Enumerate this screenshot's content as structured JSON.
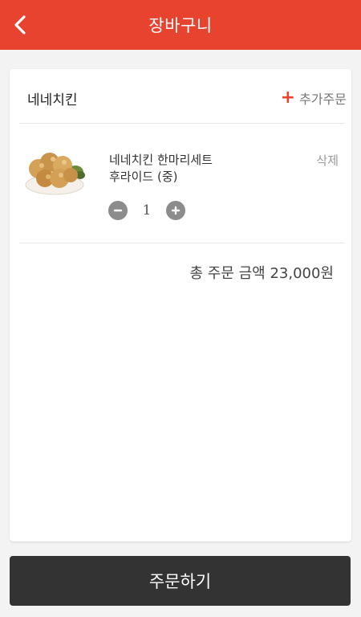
{
  "header": {
    "title": "장바구니",
    "back_icon": "chevron-left-icon"
  },
  "colors": {
    "brand": "#e8432f",
    "dark_button": "#333333",
    "qty_button": "#8c8c8c"
  },
  "cart": {
    "store_name": "네네치킨",
    "add_order_label": "추가주문",
    "items": [
      {
        "name_line1": "네네치킨 한마리세트",
        "name_line2": "후라이드 (중)",
        "delete_label": "삭제",
        "quantity": "1",
        "image": "fried-chicken-image"
      }
    ],
    "total_label": "총 주문 금액 23,000원"
  },
  "footer": {
    "order_label": "주문하기"
  }
}
